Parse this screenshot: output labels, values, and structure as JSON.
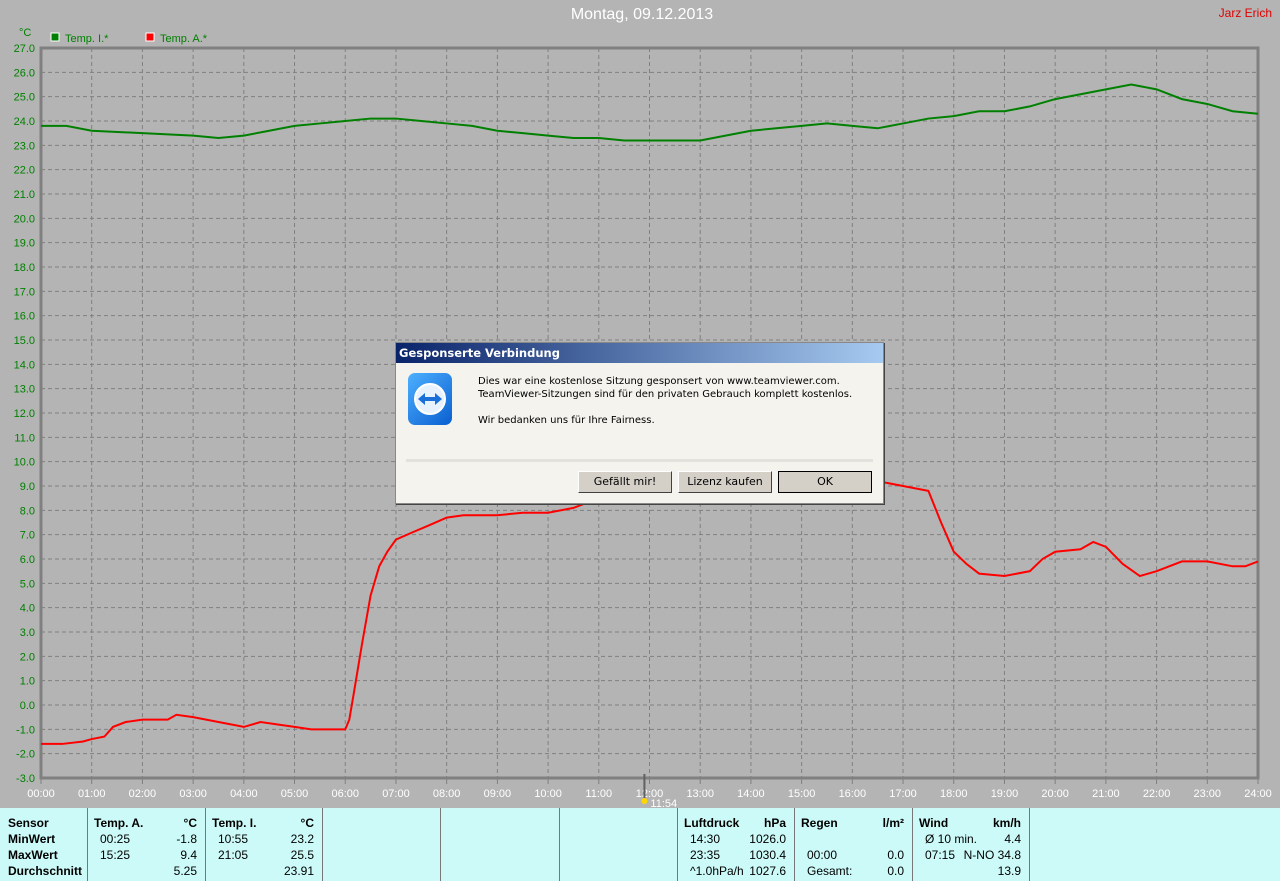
{
  "header": {
    "title": "Montag, 09.12.2013",
    "user": "Jarz Erich"
  },
  "chart_data": {
    "type": "line",
    "ylabel": "°C",
    "ylim": [
      -3,
      27
    ],
    "xlim": [
      0,
      24
    ],
    "grid": true,
    "legend_placement": "top-left",
    "yticks": [
      "27.0",
      "26.0",
      "25.0",
      "24.0",
      "23.0",
      "22.0",
      "21.0",
      "20.0",
      "19.0",
      "18.0",
      "17.0",
      "16.0",
      "15.0",
      "14.0",
      "13.0",
      "12.0",
      "11.0",
      "10.0",
      "9.0",
      "8.0",
      "7.0",
      "6.0",
      "5.0",
      "4.0",
      "3.0",
      "2.0",
      "1.0",
      "0.0",
      "-1.0",
      "-2.0",
      "-3.0"
    ],
    "xticks": [
      "00:00",
      "01:00",
      "02:00",
      "03:00",
      "04:00",
      "05:00",
      "06:00",
      "07:00",
      "08:00",
      "09:00",
      "10:00",
      "11:00",
      "12:00",
      "13:00",
      "14:00",
      "15:00",
      "16:00",
      "17:00",
      "18:00",
      "19:00",
      "20:00",
      "21:00",
      "22:00",
      "23:00",
      "24:00"
    ],
    "marker": {
      "label": "11:54",
      "x": 11.9
    },
    "series": [
      {
        "name": "Temp. I.*",
        "color": "#008000",
        "x": [
          0,
          0.5,
          1,
          2,
          3,
          3.5,
          4,
          4.5,
          5,
          5.5,
          6,
          6.5,
          7,
          7.5,
          8,
          8.5,
          9,
          9.5,
          10,
          10.5,
          11,
          11.5,
          12,
          13,
          13.5,
          14,
          14.5,
          15,
          15.5,
          16,
          16.5,
          17,
          17.5,
          18,
          18.5,
          19,
          19.5,
          20,
          20.5,
          21,
          21.5,
          22,
          22.5,
          23,
          23.5,
          24
        ],
        "y": [
          23.8,
          23.8,
          23.6,
          23.5,
          23.4,
          23.3,
          23.4,
          23.6,
          23.8,
          23.9,
          24.0,
          24.1,
          24.1,
          24.0,
          23.9,
          23.8,
          23.6,
          23.5,
          23.4,
          23.3,
          23.3,
          23.2,
          23.2,
          23.2,
          23.4,
          23.6,
          23.7,
          23.8,
          23.9,
          23.8,
          23.7,
          23.9,
          24.1,
          24.2,
          24.4,
          24.4,
          24.6,
          24.9,
          25.1,
          25.3,
          25.5,
          25.3,
          24.9,
          24.7,
          24.4,
          24.3
        ]
      },
      {
        "name": "Temp. A.*",
        "color": "#ff0000",
        "x": [
          0,
          0.42,
          0.83,
          1,
          1.25,
          1.42,
          1.67,
          2,
          2.5,
          2.67,
          3,
          3.5,
          4,
          4.33,
          4.67,
          5,
          5.33,
          5.67,
          6,
          6.08,
          6.17,
          6.33,
          6.5,
          6.67,
          6.83,
          7,
          7.33,
          7.67,
          8,
          8.33,
          9,
          9.5,
          10,
          10.5,
          11,
          12,
          13,
          14,
          15.42,
          16,
          16.5,
          17,
          17.5,
          17.75,
          18,
          18.25,
          18.5,
          19,
          19.5,
          19.75,
          20,
          20.5,
          20.75,
          21,
          21.33,
          21.67,
          22,
          22.5,
          23,
          23.5,
          23.75,
          24
        ],
        "y": [
          -1.6,
          -1.6,
          -1.5,
          -1.4,
          -1.3,
          -0.9,
          -0.7,
          -0.6,
          -0.6,
          -0.4,
          -0.5,
          -0.7,
          -0.9,
          -0.7,
          -0.8,
          -0.9,
          -1.0,
          -1.0,
          -1.0,
          -0.6,
          0.5,
          2.5,
          4.5,
          5.7,
          6.3,
          6.8,
          7.1,
          7.4,
          7.7,
          7.8,
          7.8,
          7.9,
          7.9,
          8.1,
          8.5,
          8.8,
          9.0,
          9.2,
          9.4,
          9.3,
          9.2,
          9.0,
          8.8,
          7.5,
          6.3,
          5.8,
          5.4,
          5.3,
          5.5,
          6.0,
          6.3,
          6.4,
          6.7,
          6.5,
          5.8,
          5.3,
          5.5,
          5.9,
          5.9,
          5.7,
          5.7,
          5.9
        ]
      }
    ]
  },
  "table": {
    "cols": [
      {
        "rows": [
          [
            "Sensor",
            ""
          ],
          [
            "MinWert",
            ""
          ],
          [
            "MaxWert",
            ""
          ],
          [
            "Durchschnitt",
            ""
          ]
        ]
      },
      {
        "rows": [
          [
            "Temp. A.",
            "°C"
          ],
          [
            "00:25",
            "-1.8"
          ],
          [
            "15:25",
            "9.4"
          ],
          [
            "",
            "5.25"
          ]
        ]
      },
      {
        "rows": [
          [
            "Temp. I.",
            "°C"
          ],
          [
            "10:55",
            "23.2"
          ],
          [
            "21:05",
            "25.5"
          ],
          [
            "",
            "23.91"
          ]
        ]
      },
      {
        "rows": []
      },
      {
        "rows": []
      },
      {
        "rows": []
      },
      {
        "rows": [
          [
            "Luftdruck",
            "hPa"
          ],
          [
            "14:30",
            "1026.0"
          ],
          [
            "23:35",
            "1030.4"
          ],
          [
            "^1.0hPa/h",
            "1027.6"
          ]
        ]
      },
      {
        "rows": [
          [
            "Regen",
            "l/m²"
          ],
          [
            "",
            ""
          ],
          [
            "00:00",
            "0.0"
          ],
          [
            "Gesamt:",
            "0.0"
          ]
        ]
      },
      {
        "rows": [
          [
            "Wind",
            "km/h"
          ],
          [
            "Ø 10 min.",
            "4.4"
          ],
          [
            "07:15",
            "N-NO 34.8"
          ],
          [
            "",
            "13.9"
          ]
        ]
      }
    ]
  },
  "dialog": {
    "title": "Gesponserte Verbindung",
    "line1": "Dies war eine kostenlose Sitzung gesponsert von www.teamviewer.com.",
    "line2": "TeamViewer-Sitzungen sind für den privaten Gebrauch komplett kostenlos.",
    "line3": "Wir bedanken uns für Ihre Fairness.",
    "btn_like": "Gefällt mir!",
    "btn_license": "Lizenz kaufen",
    "btn_ok": "OK"
  }
}
